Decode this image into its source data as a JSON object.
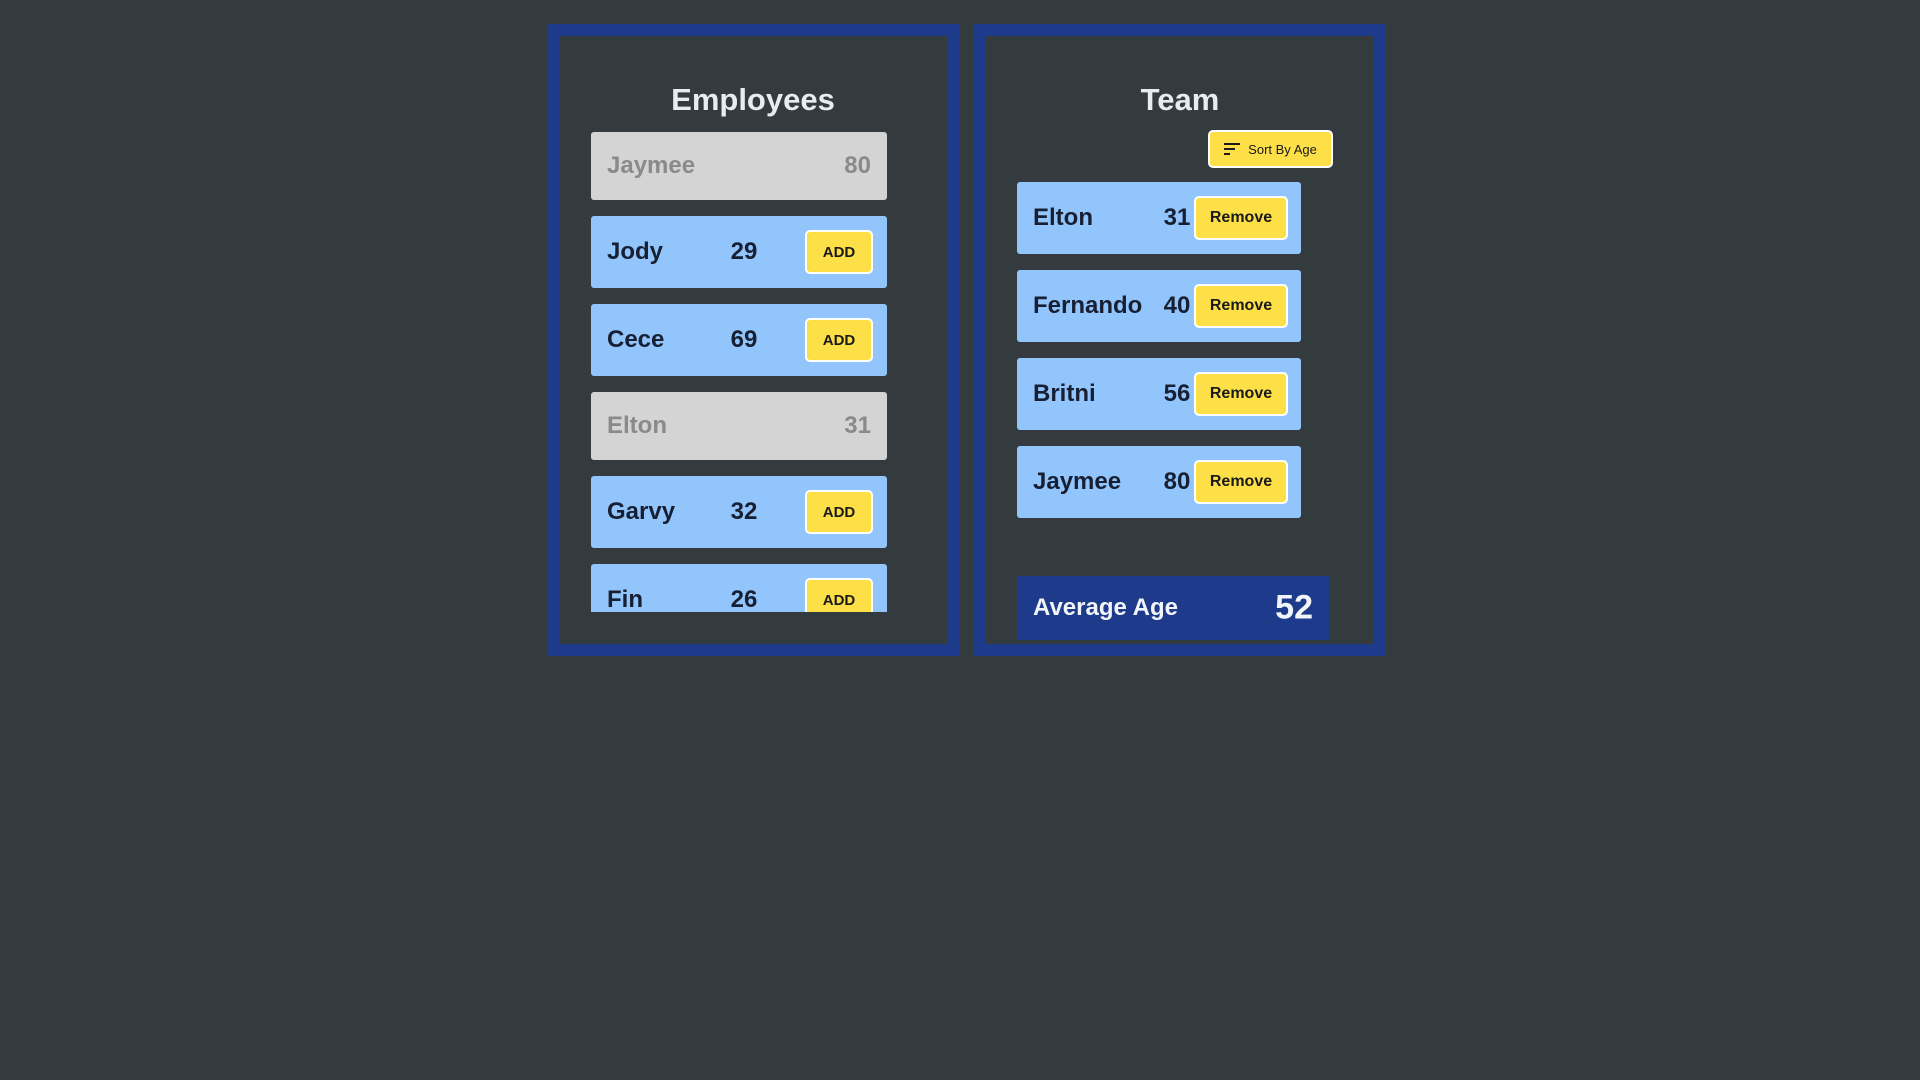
{
  "employees": {
    "title": "Employees",
    "add_label": "ADD",
    "items": [
      {
        "name": "Jaymee",
        "age": "80",
        "in_team": true
      },
      {
        "name": "Jody",
        "age": "29",
        "in_team": false
      },
      {
        "name": "Cece",
        "age": "69",
        "in_team": false
      },
      {
        "name": "Elton",
        "age": "31",
        "in_team": true
      },
      {
        "name": "Garvy",
        "age": "32",
        "in_team": false
      },
      {
        "name": "Fin",
        "age": "26",
        "in_team": false
      }
    ]
  },
  "team": {
    "title": "Team",
    "sort_label": "Sort By Age",
    "sort_icon": "sort-lines-icon",
    "remove_label": "Remove",
    "members": [
      {
        "name": "Elton",
        "age": "31"
      },
      {
        "name": "Fernando",
        "age": "40"
      },
      {
        "name": "Britni",
        "age": "56"
      },
      {
        "name": "Jaymee",
        "age": "80"
      }
    ],
    "average_label": "Average Age",
    "average_value": "52"
  },
  "colors": {
    "background": "#343b3f",
    "panel_border": "#1e3a8a",
    "card_active": "#93c5fd",
    "card_taken": "#d4d4d4",
    "button": "#fde047"
  }
}
